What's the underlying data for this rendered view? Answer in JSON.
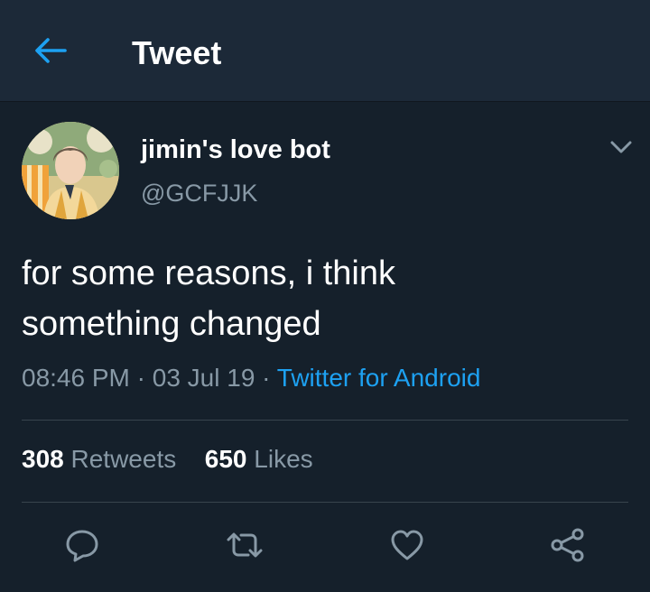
{
  "header": {
    "title": "Tweet",
    "back_icon": "arrow-left-icon"
  },
  "tweet": {
    "display_name": "jimin's love bot",
    "handle": "@GCFJJK",
    "text_line1": "for some reasons, i think",
    "text_line2": "something changed",
    "time": "08:46 PM",
    "separator": "·",
    "date": "03 Jul 19",
    "source": "Twitter for Android",
    "retweet_count": "308",
    "retweet_label": "Retweets",
    "like_count": "650",
    "like_label": "Likes"
  },
  "actions": [
    {
      "icon": "reply-icon"
    },
    {
      "icon": "retweet-icon"
    },
    {
      "icon": "heart-icon"
    },
    {
      "icon": "share-icon"
    }
  ],
  "colors": {
    "background": "#15202b",
    "header": "#1c2938",
    "accent": "#1da1f2",
    "muted": "#8899a6",
    "divider": "#38444d"
  }
}
